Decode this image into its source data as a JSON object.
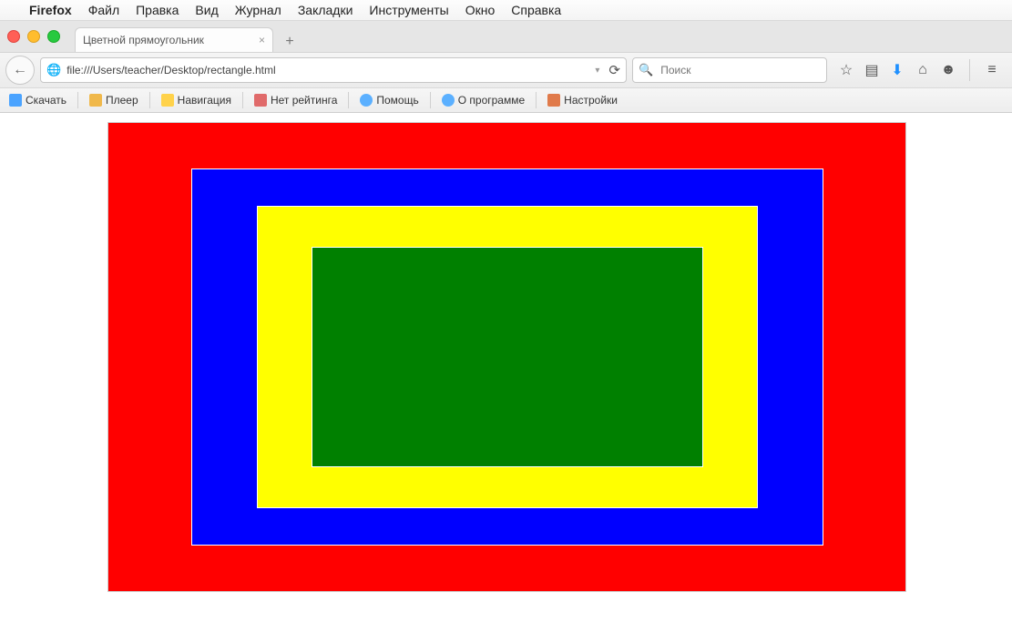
{
  "menubar": {
    "app": "Firefox",
    "items": [
      "Файл",
      "Правка",
      "Вид",
      "Журнал",
      "Закладки",
      "Инструменты",
      "Окно",
      "Справка"
    ]
  },
  "tab": {
    "title": "Цветной прямоугольник"
  },
  "url": "file:///Users/teacher/Desktop/rectangle.html",
  "search": {
    "placeholder": "Поиск"
  },
  "addonbar": {
    "items": [
      {
        "label": "Скачать",
        "color": "#4aa3ff"
      },
      {
        "label": "Плеер",
        "color": "#f0b84a"
      },
      {
        "label": "Навигация",
        "color": "#ffd24a"
      },
      {
        "label": "Нет рейтинга",
        "color": "#e06a6a"
      },
      {
        "label": "Помощь",
        "color": "#5bb0ff"
      },
      {
        "label": "О программе",
        "color": "#5bb0ff"
      },
      {
        "label": "Настройки",
        "color": "#e07a4a"
      }
    ]
  },
  "rect_colors": {
    "outer": "#ff0000",
    "second": "#0000ff",
    "third": "#ffff00",
    "inner": "#008000"
  }
}
